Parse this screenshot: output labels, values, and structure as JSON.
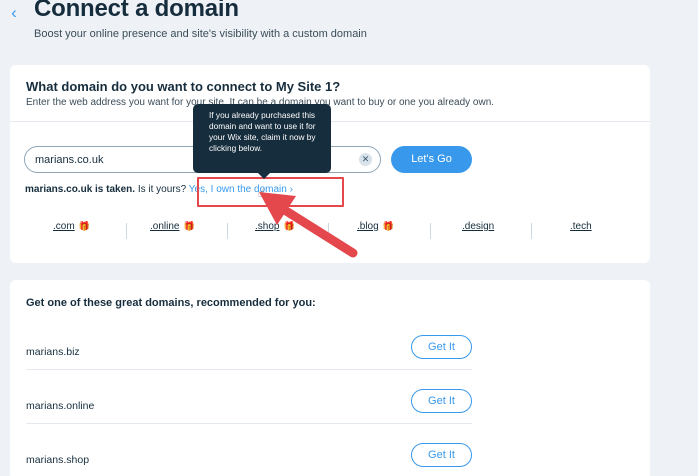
{
  "header": {
    "back_icon": "chevron-left-icon",
    "title": "Connect a domain",
    "subtitle": "Boost your online presence and site's visibility with a custom domain"
  },
  "connect_card": {
    "title": "What domain do you want to connect to My Site 1?",
    "description": "Enter the web address you want for your site. It can be a domain you want to buy or one you already own.",
    "search_value": "marians.co.uk",
    "go_label": "Let's Go",
    "taken_domain": "marians.co.uk is taken.",
    "taken_question": " Is it yours? ",
    "own_link": "Yes, I own the domain",
    "own_link_chevron": "›",
    "tooltip": "If you already purchased this domain and want to use it for your Wix site, claim it now by clicking below.",
    "tlds": [
      {
        "label": ".com",
        "gift": true
      },
      {
        "label": ".online",
        "gift": true
      },
      {
        "label": ".shop",
        "gift": true
      },
      {
        "label": ".blog",
        "gift": true
      },
      {
        "label": ".design",
        "gift": false
      },
      {
        "label": ".tech",
        "gift": false
      }
    ]
  },
  "recommendations": {
    "title": "Get one of these great domains, recommended for you:",
    "items": [
      {
        "domain": "marians.biz",
        "button": "Get It"
      },
      {
        "domain": "marians.online",
        "button": "Get It"
      },
      {
        "domain": "marians.shop",
        "button": "Get It"
      }
    ]
  },
  "colors": {
    "accent": "#3899ec",
    "background": "#eef2f6",
    "tooltip": "#162d3d",
    "annotation": "#e4474c",
    "gift": "#b45ab8"
  }
}
